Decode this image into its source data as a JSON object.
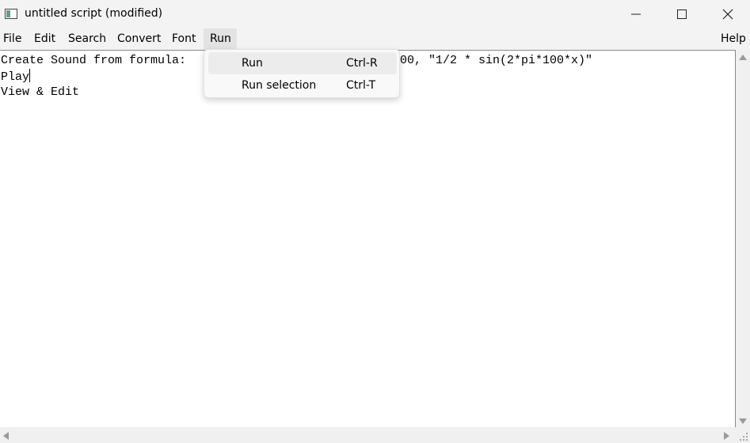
{
  "window": {
    "title": "untitled script (modified)",
    "icons": {
      "app": "praat-script-icon",
      "minimize": "minimize-icon",
      "maximize": "maximize-icon",
      "close": "close-icon"
    }
  },
  "menubar": {
    "items": [
      "File",
      "Edit",
      "Search",
      "Convert",
      "Font",
      "Run"
    ],
    "active": "Run",
    "help": "Help"
  },
  "editor": {
    "lines": [
      "Create Sound from formula:",
      "00, \"1/2 * sin(2*pi*100*x)\"",
      "Play",
      "View & Edit"
    ]
  },
  "run_menu": {
    "items": [
      {
        "label": "Run",
        "shortcut": "Ctrl-R"
      },
      {
        "label": "Run selection",
        "shortcut": "Ctrl-T"
      }
    ]
  },
  "scrollbars": {
    "icons": [
      "scroll-up-icon",
      "scroll-down-icon",
      "scroll-left-icon",
      "scroll-right-icon",
      "resize-grip-icon"
    ]
  }
}
